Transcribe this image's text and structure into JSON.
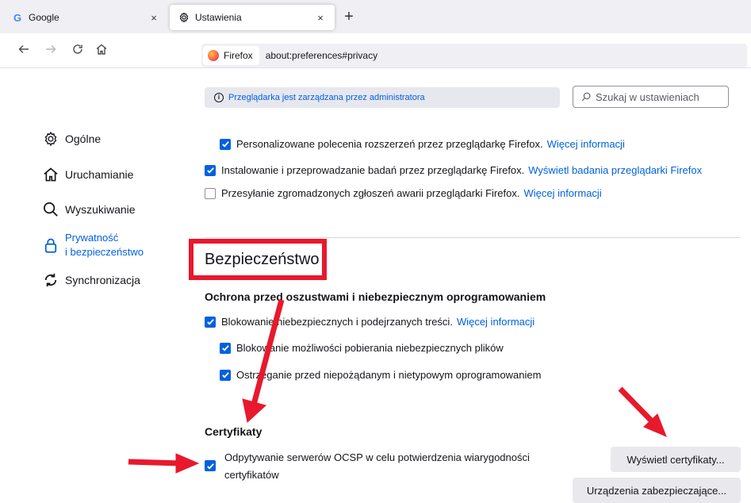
{
  "tabs": [
    {
      "favicon": "G",
      "title": "Google",
      "close": "×"
    },
    {
      "favicon": "gear-icon",
      "title": "Ustawienia",
      "close": "×"
    }
  ],
  "new_tab": "+",
  "nav": {
    "identity_label": "Firefox",
    "url": "about:preferences#privacy"
  },
  "admin_notice": "Przeglądarka jest zarządzana przez administratora",
  "search": {
    "placeholder": "Szukaj w ustawieniach"
  },
  "sidebar": {
    "items": [
      {
        "label": "Ogólne",
        "icon": "gear-icon"
      },
      {
        "label": "Uruchamianie",
        "icon": "home-icon"
      },
      {
        "label": "Wyszukiwanie",
        "icon": "search-icon"
      },
      {
        "label_line1": "Prywatność",
        "label_line2": "i bezpieczeństwo",
        "icon": "lock-icon",
        "selected": true
      },
      {
        "label": "Synchronizacja",
        "icon": "sync-icon"
      }
    ]
  },
  "data_collection": {
    "personalized": {
      "label": "Personalizowane polecenia rozszerzeń przez przeglądarkę Firefox.",
      "link": "Więcej informacji",
      "checked": true
    },
    "studies": {
      "label": "Instalowanie i przeprowadzanie badań przez przeglądarkę Firefox.",
      "link": "Wyświetl badania przeglądarki Firefox",
      "checked": true
    },
    "crash_reports": {
      "label": "Przesyłanie zgromadzonych zgłoszeń awarii przeglądarki Firefox.",
      "link": "Więcej informacji",
      "checked": false
    }
  },
  "security": {
    "title": "Bezpieczeństwo",
    "protection_title": "Ochrona przed oszustwami i niebezpiecznym oprogramowaniem",
    "block_dangerous": {
      "label": "Blokowanie niebezpiecznych i podejrzanych treści.",
      "link": "Więcej informacji",
      "checked": true
    },
    "block_downloads": {
      "label": "Blokowanie możliwości pobierania niebezpiecznych plików",
      "checked": true
    },
    "warn_unwanted": {
      "label": "Ostrzeganie przed niepożądanym i nietypowym oprogramowaniem",
      "checked": true
    },
    "certificates_title": "Certyfikaty",
    "ocsp": {
      "line1": "Odpytywanie serwerów OCSP w celu potwierdzenia wiarygodności",
      "line2": "certyfikatów",
      "checked": true
    },
    "view_certs_button": "Wyświetl certyfikaty...",
    "security_devices_button": "Urządzenia zabezpieczające..."
  },
  "colors": {
    "accent": "#0061e0",
    "annotation_red": "#e8192c"
  }
}
